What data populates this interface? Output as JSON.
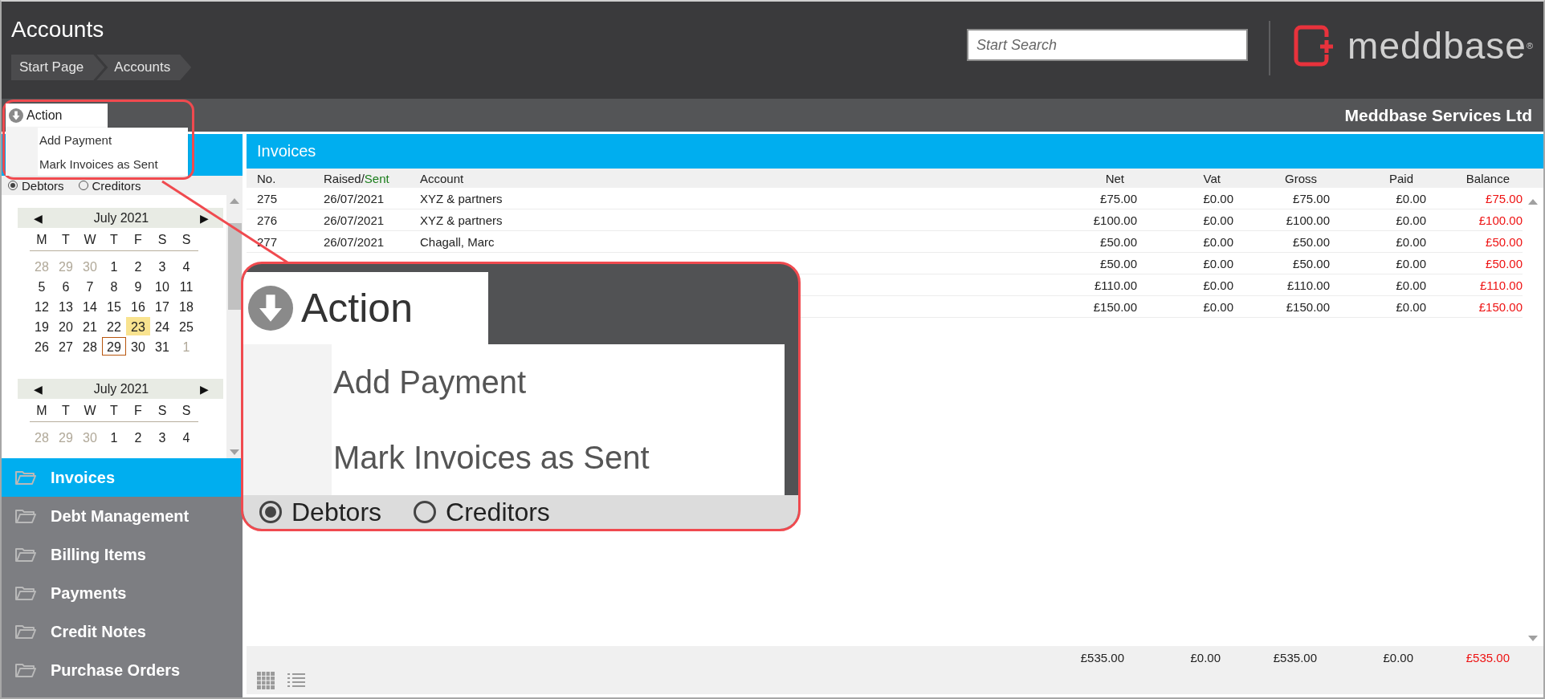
{
  "header": {
    "title": "Accounts",
    "breadcrumbs": [
      {
        "label": "Start Page"
      },
      {
        "label": "Accounts"
      }
    ],
    "search": {
      "placeholder": "Start Search"
    },
    "logo": {
      "text": "meddbase",
      "mark": "®"
    }
  },
  "subheader": {
    "company": "Meddbase Services Ltd"
  },
  "action_menu": {
    "label": "Action",
    "items": [
      "Add Payment",
      "Mark Invoices as Sent"
    ]
  },
  "filter": {
    "options": [
      {
        "label": "Debtors",
        "selected": true
      },
      {
        "label": "Creditors",
        "selected": false
      }
    ]
  },
  "calendars": [
    {
      "prev": "◀",
      "month": "July 2021",
      "next": "▶",
      "weekdays": [
        "M",
        "T",
        "W",
        "T",
        "F",
        "S",
        "S"
      ],
      "days": [
        {
          "label": "28",
          "muted": true,
          "highlighted": false,
          "selected": false
        },
        {
          "label": "29",
          "muted": true,
          "highlighted": false,
          "selected": false
        },
        {
          "label": "30",
          "muted": true,
          "highlighted": false,
          "selected": false
        },
        {
          "label": "1",
          "muted": false,
          "highlighted": false,
          "selected": false
        },
        {
          "label": "2",
          "muted": false,
          "highlighted": false,
          "selected": false
        },
        {
          "label": "3",
          "muted": false,
          "highlighted": false,
          "selected": false
        },
        {
          "label": "4",
          "muted": false,
          "highlighted": false,
          "selected": false
        },
        {
          "label": "5",
          "muted": false,
          "highlighted": false,
          "selected": false
        },
        {
          "label": "6",
          "muted": false,
          "highlighted": false,
          "selected": false
        },
        {
          "label": "7",
          "muted": false,
          "highlighted": false,
          "selected": false
        },
        {
          "label": "8",
          "muted": false,
          "highlighted": false,
          "selected": false
        },
        {
          "label": "9",
          "muted": false,
          "highlighted": false,
          "selected": false
        },
        {
          "label": "10",
          "muted": false,
          "highlighted": false,
          "selected": false
        },
        {
          "label": "11",
          "muted": false,
          "highlighted": false,
          "selected": false
        },
        {
          "label": "12",
          "muted": false,
          "highlighted": false,
          "selected": false
        },
        {
          "label": "13",
          "muted": false,
          "highlighted": false,
          "selected": false
        },
        {
          "label": "14",
          "muted": false,
          "highlighted": false,
          "selected": false
        },
        {
          "label": "15",
          "muted": false,
          "highlighted": false,
          "selected": false
        },
        {
          "label": "16",
          "muted": false,
          "highlighted": false,
          "selected": false
        },
        {
          "label": "17",
          "muted": false,
          "highlighted": false,
          "selected": false
        },
        {
          "label": "18",
          "muted": false,
          "highlighted": false,
          "selected": false
        },
        {
          "label": "19",
          "muted": false,
          "highlighted": false,
          "selected": false
        },
        {
          "label": "20",
          "muted": false,
          "highlighted": false,
          "selected": false
        },
        {
          "label": "21",
          "muted": false,
          "highlighted": false,
          "selected": false
        },
        {
          "label": "22",
          "muted": false,
          "highlighted": false,
          "selected": false
        },
        {
          "label": "23",
          "muted": false,
          "highlighted": true,
          "selected": false
        },
        {
          "label": "24",
          "muted": false,
          "highlighted": false,
          "selected": false
        },
        {
          "label": "25",
          "muted": false,
          "highlighted": false,
          "selected": false
        },
        {
          "label": "26",
          "muted": false,
          "highlighted": false,
          "selected": false
        },
        {
          "label": "27",
          "muted": false,
          "highlighted": false,
          "selected": false
        },
        {
          "label": "28",
          "muted": false,
          "highlighted": false,
          "selected": false
        },
        {
          "label": "29",
          "muted": false,
          "highlighted": false,
          "selected": true
        },
        {
          "label": "30",
          "muted": false,
          "highlighted": false,
          "selected": false
        },
        {
          "label": "31",
          "muted": false,
          "highlighted": false,
          "selected": false
        },
        {
          "label": "1",
          "muted": true,
          "highlighted": false,
          "selected": false
        }
      ]
    },
    {
      "prev": "◀",
      "month": "July 2021",
      "next": "▶",
      "weekdays": [
        "M",
        "T",
        "W",
        "T",
        "F",
        "S",
        "S"
      ],
      "days": [
        {
          "label": "28",
          "muted": true,
          "highlighted": false,
          "selected": false
        },
        {
          "label": "29",
          "muted": true,
          "highlighted": false,
          "selected": false
        },
        {
          "label": "30",
          "muted": true,
          "highlighted": false,
          "selected": false
        },
        {
          "label": "1",
          "muted": false,
          "highlighted": false,
          "selected": false
        },
        {
          "label": "2",
          "muted": false,
          "highlighted": false,
          "selected": false
        },
        {
          "label": "3",
          "muted": false,
          "highlighted": false,
          "selected": false
        },
        {
          "label": "4",
          "muted": false,
          "highlighted": false,
          "selected": false
        }
      ]
    }
  ],
  "sidebar": {
    "items": [
      {
        "label": "Invoices",
        "selected": true
      },
      {
        "label": "Debt Management",
        "selected": false
      },
      {
        "label": "Billing Items",
        "selected": false
      },
      {
        "label": "Payments",
        "selected": false
      },
      {
        "label": "Credit Notes",
        "selected": false
      },
      {
        "label": "Purchase Orders",
        "selected": false
      }
    ]
  },
  "invoices": {
    "title": "Invoices",
    "columns": [
      {
        "kind": "text",
        "parts": [
          "No."
        ]
      },
      {
        "kind": "text",
        "parts": [
          "Raised/",
          "Sent"
        ]
      },
      {
        "kind": "text",
        "parts": [
          "Account"
        ]
      },
      {
        "kind": "money",
        "parts": [
          "Net"
        ]
      },
      {
        "kind": "money",
        "parts": [
          "Vat"
        ]
      },
      {
        "kind": "money",
        "parts": [
          "Gross"
        ]
      },
      {
        "kind": "money",
        "parts": [
          "Paid"
        ]
      },
      {
        "kind": "balance",
        "parts": [
          "Balance"
        ]
      }
    ],
    "rows": [
      {
        "cells": [
          "275",
          "26/07/2021",
          "XYZ & partners",
          "£75.00",
          "£0.00",
          "£75.00",
          "£0.00",
          "£75.00"
        ]
      },
      {
        "cells": [
          "276",
          "26/07/2021",
          "XYZ & partners",
          "£100.00",
          "£0.00",
          "£100.00",
          "£0.00",
          "£100.00"
        ]
      },
      {
        "cells": [
          "277",
          "26/07/2021",
          "Chagall, Marc",
          "£50.00",
          "£0.00",
          "£50.00",
          "£0.00",
          "£50.00"
        ]
      },
      {
        "cells": [
          "",
          "",
          "",
          "£50.00",
          "£0.00",
          "£50.00",
          "£0.00",
          "£50.00"
        ]
      },
      {
        "cells": [
          "",
          "",
          "",
          "£110.00",
          "£0.00",
          "£110.00",
          "£0.00",
          "£110.00"
        ]
      },
      {
        "cells": [
          "",
          "",
          "",
          "£150.00",
          "£0.00",
          "£150.00",
          "£0.00",
          "£150.00"
        ]
      }
    ],
    "totals": [
      "£535.00",
      "£0.00",
      "£535.00",
      "£0.00",
      "£535.00"
    ]
  },
  "callout": {
    "action": "Action",
    "items": [
      "Add Payment",
      "Mark Invoices as Sent"
    ],
    "options": [
      {
        "label": "Debtors",
        "selected": true
      },
      {
        "label": "Creditors",
        "selected": false
      }
    ]
  }
}
